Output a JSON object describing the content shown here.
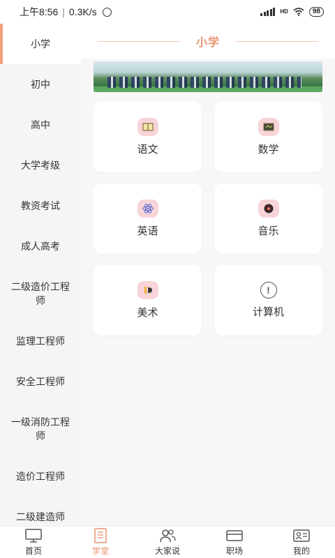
{
  "status_bar": {
    "time": "上午8:56",
    "speed": "0.3K/s",
    "separator": "|",
    "network": "HD",
    "battery": "98"
  },
  "sidebar": {
    "items": [
      {
        "label": "小学",
        "active": true
      },
      {
        "label": "初中"
      },
      {
        "label": "高中"
      },
      {
        "label": "大学考级"
      },
      {
        "label": "教资考试"
      },
      {
        "label": "成人高考"
      },
      {
        "label": "二级造价工程师"
      },
      {
        "label": "监理工程师"
      },
      {
        "label": "安全工程师"
      },
      {
        "label": "一级消防工程师"
      },
      {
        "label": "造价工程师"
      },
      {
        "label": "二级建造师"
      }
    ]
  },
  "main": {
    "category_title": "小学",
    "subjects": [
      {
        "label": "语文",
        "icon": "book-icon"
      },
      {
        "label": "数学",
        "icon": "blackboard-icon"
      },
      {
        "label": "英语",
        "icon": "atom-icon"
      },
      {
        "label": "音乐",
        "icon": "record-icon"
      },
      {
        "label": "美术",
        "icon": "paint-icon"
      },
      {
        "label": "计算机",
        "icon": "exclamation-icon"
      }
    ]
  },
  "tabbar": {
    "items": [
      {
        "label": "首页",
        "icon": "monitor-icon"
      },
      {
        "label": "学堂",
        "icon": "notebook-icon",
        "active": true
      },
      {
        "label": "大家说",
        "icon": "people-icon"
      },
      {
        "label": "职场",
        "icon": "card-icon"
      },
      {
        "label": "我的",
        "icon": "id-card-icon"
      }
    ]
  },
  "colors": {
    "accent": "#e8936a",
    "sidebar_bg": "#f5f5f5",
    "icon_bg": "#f7d4d8"
  }
}
